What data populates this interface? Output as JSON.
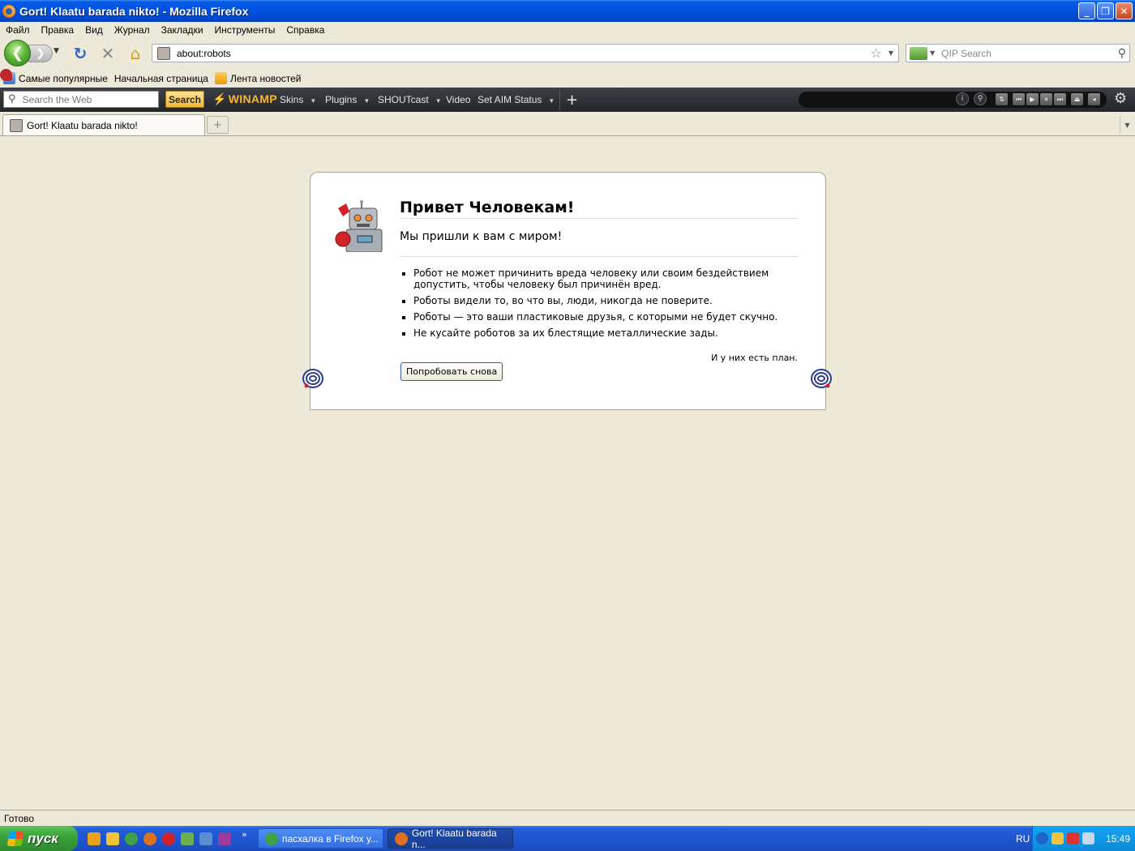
{
  "window": {
    "title": "Gort! Klaatu barada nikto! - Mozilla Firefox",
    "controls": {
      "minimize": "_",
      "maximize": "❐",
      "close": "✕"
    }
  },
  "menu": {
    "items": [
      "Файл",
      "Правка",
      "Вид",
      "Журнал",
      "Закладки",
      "Инструменты",
      "Справка"
    ]
  },
  "nav": {
    "url": "about:robots",
    "search_placeholder": "QIP Search"
  },
  "bookmarks": {
    "items": [
      "Самые популярные",
      "Начальная страница",
      "Лента новостей"
    ]
  },
  "winamp": {
    "search_placeholder": "Search the Web",
    "search_button": "Search",
    "logo": "WINAMP",
    "menus": [
      "Skins",
      "Plugins",
      "SHOUTcast",
      "Video",
      "Set AIM Status"
    ]
  },
  "tabs": {
    "active_label": "Gort! Klaatu barada nikto!"
  },
  "page": {
    "heading": "Привет Человекам!",
    "subtitle": "Мы пришли к вам с миром!",
    "bullets": [
      "Робот не может причинить вреда человеку или своим бездействием допустить, чтобы человеку был причинён вред.",
      "Роботы видели то, во что вы, люди, никогда не поверите.",
      "Роботы — это ваши пластиковые друзья, с которыми не будет скучно.",
      "Не кусайте роботов за их блестящие металлические зады."
    ],
    "plan": "И у них есть план.",
    "retry_button": "Попробовать снова"
  },
  "status": {
    "text": "Готово"
  },
  "taskbar": {
    "start_label": "пуск",
    "tasks": [
      "пасхалка в Firefox у...",
      "Gort! Klaatu barada n..."
    ],
    "lang": "RU",
    "clock": "15:49"
  },
  "colors": {
    "titlebar": "#0054e3",
    "winamp_bar": "#2c2f34",
    "winamp_accent": "#f7b736",
    "content_bg": "#ece9d8",
    "taskbar": "#245edb",
    "start": "#3aa33b"
  }
}
